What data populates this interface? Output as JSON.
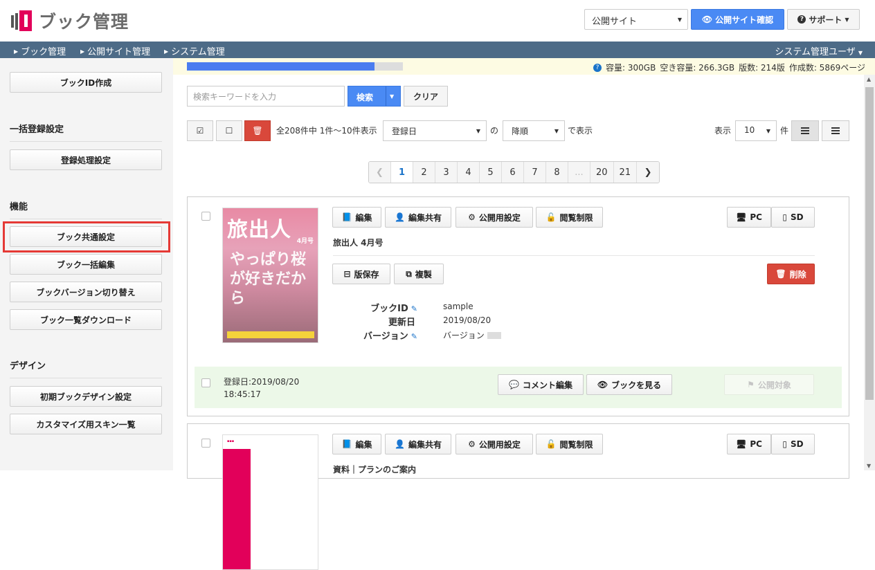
{
  "header": {
    "app_title": "ブック管理",
    "site_select": "公開サイト",
    "confirm_label": "公開サイト確認",
    "support_label": "サポート"
  },
  "nav": {
    "items": [
      "ブック管理",
      "公開サイト管理",
      "システム管理"
    ],
    "user": "システム管理ユーザ"
  },
  "sidebar": {
    "create_id": "ブックID作成",
    "bulk_head": "一括登録設定",
    "reg_settings": "登録処理設定",
    "func_head": "機能",
    "common_settings": "ブック共通設定",
    "bulk_edit": "ブック一括編集",
    "version_switch": "ブックバージョン切り替え",
    "list_download": "ブック一覧ダウンロード",
    "design_head": "デザイン",
    "initial_design": "初期ブックデザイン設定",
    "skin_list": "カスタマイズ用スキン一覧"
  },
  "storage": {
    "progress": 0.87,
    "capacity": "容量: 300GB",
    "free": "空き容量: 266.3GB",
    "editions": "版数: 214版",
    "pages": "作成数: 5869ページ"
  },
  "search": {
    "placeholder": "検索キーワードを入力",
    "search_label": "検索",
    "clear_label": "クリア"
  },
  "toolbar": {
    "count_text": "全208件中 1件～10件表示",
    "sort_field": "登録日",
    "of": "の",
    "order": "降順",
    "display_suffix": "で表示",
    "show_label": "表示",
    "per_page": "10",
    "per_unit": "件"
  },
  "pagination": {
    "pages": [
      "1",
      "2",
      "3",
      "4",
      "5",
      "6",
      "7",
      "8",
      "...",
      "20",
      "21"
    ],
    "current": "1"
  },
  "actions": {
    "edit": "編集",
    "share": "編集共有",
    "publish_settings": "公開用設定",
    "restrict": "閲覧制限",
    "pc": "PC",
    "sd": "SD",
    "save_version": "版保存",
    "duplicate": "複製",
    "delete": "削除",
    "comment_edit": "コメント編集",
    "view_book": "ブックを見る",
    "publish_target": "公開対象"
  },
  "books": [
    {
      "title": "旅出人 4月号",
      "id_label": "ブックID",
      "id_value": "sample",
      "updated_label": "更新日",
      "updated_value": "2019/08/20",
      "version_label": "バージョン",
      "version_value": "バージョン",
      "registered": "登録日:2019/08/20",
      "registered_time": "18:45:17",
      "cover": {
        "title": "旅出人",
        "month": "4月号",
        "copy": "やっぱり桜が好きだから"
      }
    },
    {
      "title": "資料｜プランのご案内"
    }
  ],
  "colors": {
    "accent_blue": "#4a8af4",
    "nav_bg": "#4d6b87",
    "danger": "#d9483b",
    "highlight": "#e53935",
    "brand": "#e2005a"
  }
}
